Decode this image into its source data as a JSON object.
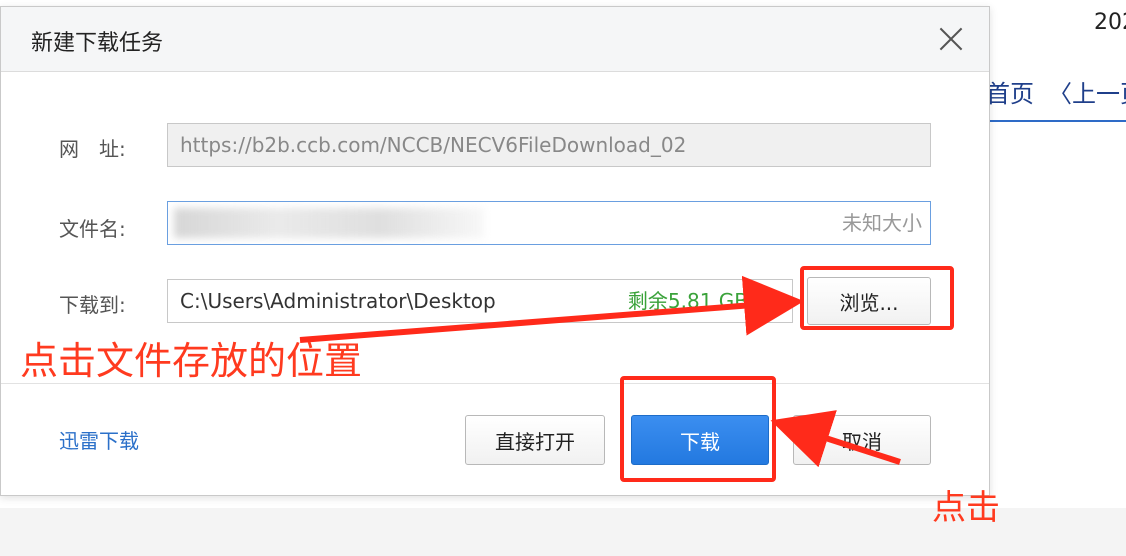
{
  "background": {
    "year_fragment": "202",
    "nav_home": "首页",
    "nav_prev": "〈上一页"
  },
  "dialog": {
    "title": "新建下载任务",
    "url_label": "网　址:",
    "url_value": "https://b2b.ccb.com/NCCB/NECV6FileDownload_02",
    "filename_label": "文件名:",
    "size_hint": "未知大小",
    "save_label": "下载到:",
    "save_path": "C:\\Users\\Administrator\\Desktop",
    "free_space": "剩余5.81 GB",
    "browse_button": "浏览...",
    "thunder_link": "迅雷下载",
    "open_button": "直接打开",
    "download_button": "下载",
    "cancel_button": "取消"
  },
  "annotations": {
    "note_location": "点击文件存放的位置",
    "note_click": "点击",
    "color": "#ff2a1a"
  },
  "icons": {
    "close": "close-icon",
    "dropdown": "chevron-down-icon"
  }
}
